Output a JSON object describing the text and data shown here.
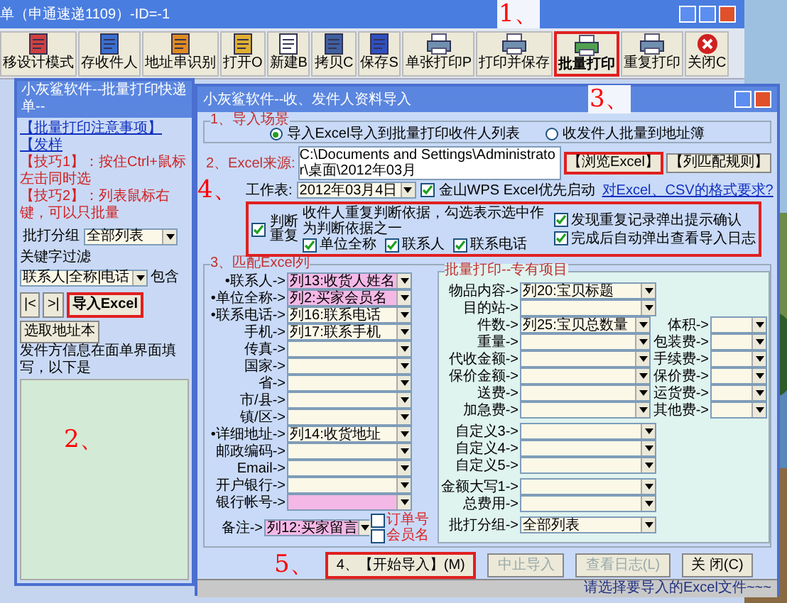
{
  "main_window": {
    "title": "单（申通速递1109）-ID=-1",
    "toolbar": [
      {
        "label": "移设计模式",
        "boxed": false
      },
      {
        "label": "存收件人",
        "boxed": false
      },
      {
        "label": "地址串识别",
        "boxed": false
      },
      {
        "label": "打开O",
        "boxed": false
      },
      {
        "label": "新建B",
        "boxed": false
      },
      {
        "label": "拷贝C",
        "boxed": false
      },
      {
        "label": "保存S",
        "boxed": false
      },
      {
        "label": "单张打印P",
        "boxed": false
      },
      {
        "label": "打印并保存",
        "boxed": false
      },
      {
        "label": "批量打印",
        "boxed": true
      },
      {
        "label": "重复打印",
        "boxed": false
      },
      {
        "label": "关闭C",
        "boxed": false
      }
    ]
  },
  "batch_window": {
    "title": "小灰鲨软件--批量打印快递单--",
    "links": [
      "【批量打印注意事项】",
      "【发样"
    ],
    "tips": [
      "【技巧1】：按住Ctrl+鼠标左击同时选",
      "【技巧2】：列表鼠标右键，可以只批量"
    ],
    "group_label": "批打分组",
    "group_value": "全部列表",
    "filter_label": "关键字过滤",
    "filter_value": "联系人|全称|电话",
    "filter_mode": "包含",
    "nav": [
      {
        "label": "|<",
        "boxed": false
      },
      {
        "label": ">|",
        "boxed": false
      },
      {
        "label": "导入Excel",
        "boxed": true
      },
      {
        "label": "选取地址本",
        "boxed": false
      }
    ],
    "note": "发件方信息在面单界面填写，以下是"
  },
  "import_dialog": {
    "title": "小灰鲨软件--收、发件人资料导入",
    "scene_label": "1、导入场景",
    "scenes": [
      {
        "label": "导入Excel导入到批量打印收件人列表",
        "selected": true
      },
      {
        "label": "收发件人批量到地址簿",
        "selected": false
      }
    ],
    "source_label": "2、Excel来源:",
    "source_value": "C:\\Documents and Settings\\Administrator\\桌面\\2012年03月",
    "browse_button": {
      "label": "【浏览Excel】",
      "boxed": true
    },
    "rules_button": {
      "label": "【列匹配规则】",
      "boxed": false
    },
    "sheet_label": "工作表:",
    "sheet_value": "2012年03月4日",
    "wps": {
      "label": "金山WPS Excel优先启动",
      "checked": true
    },
    "format_link": "对Excel、CSV的格式要求?",
    "dup_check": {
      "label": "判断重复",
      "checked": true
    },
    "dup_hint": "收件人重复判断依据，勾选表示选中作为判断依据之一",
    "dup_fields": [
      {
        "label": "单位全称",
        "checked": true
      },
      {
        "label": "联系人",
        "checked": true
      },
      {
        "label": "联系电话",
        "checked": true
      }
    ],
    "dup_options": [
      {
        "label": "发现重复记录弹出提示确认",
        "checked": true
      },
      {
        "label": "完成后自动弹出查看导入日志",
        "checked": true
      }
    ],
    "match_title": "3、匹配Excel列",
    "fields": [
      {
        "label": "•联系人->",
        "value": "列13:收货人姓名",
        "highlight": true
      },
      {
        "label": "•单位全称->",
        "value": "列2:买家会员名",
        "highlight": true
      },
      {
        "label": "•联系电话->",
        "value": "列16:联系电话",
        "highlight": false
      },
      {
        "label": "手机->",
        "value": "列17:联系手机",
        "highlight": false
      },
      {
        "label": "传真->",
        "highlight": false
      },
      {
        "label": "国家->",
        "highlight": false
      },
      {
        "label": "省->",
        "highlight": false
      },
      {
        "label": "市/县->",
        "highlight": false
      },
      {
        "label": "镇/区->",
        "highlight": false
      },
      {
        "label": "•详细地址->",
        "value": "列14:收货地址",
        "highlight": false
      },
      {
        "label": "邮政编码->",
        "highlight": false
      },
      {
        "label": "Email->",
        "highlight": false
      },
      {
        "label": "开户银行->",
        "highlight": false
      },
      {
        "label": "银行帐号->",
        "highlight": true
      }
    ],
    "remark": {
      "label": "备注->",
      "value": "列12:买家留言",
      "extras": [
        {
          "label": "订单号",
          "checked": false
        },
        {
          "label": "会员名",
          "checked": false
        }
      ]
    },
    "print_group_title": "批量打印--专有项目",
    "print_rows": [
      [
        {
          "label": "物品内容->",
          "value": "列20:宝贝标题"
        }
      ],
      [
        {
          "label": "目的站->"
        }
      ],
      [
        {
          "label": "件数->",
          "value": "列25:宝贝总数量"
        },
        {
          "label": "体积->"
        }
      ],
      [
        {
          "label": "重量->"
        },
        {
          "label": "包装费->"
        }
      ],
      [
        {
          "label": "代收金额->"
        },
        {
          "label": "手续费->"
        }
      ],
      [
        {
          "label": "保价金额->"
        },
        {
          "label": "保价费->"
        }
      ],
      [
        {
          "label": "送费->"
        },
        {
          "label": "运货费->"
        }
      ],
      [
        {
          "label": "加急费->"
        },
        {
          "label": "其他费->"
        }
      ],
      [
        {
          "label": "自定义3->"
        }
      ],
      [
        {
          "label": "自定义4->"
        }
      ],
      [
        {
          "label": "自定义5->"
        }
      ],
      [
        {
          "label": "金额大写1->"
        }
      ],
      [
        {
          "label": "总费用->"
        }
      ],
      [
        {
          "label": "批打分组->",
          "value": "全部列表"
        }
      ]
    ],
    "buttons": [
      {
        "label": "4、【开始导入】(M)",
        "disabled": false,
        "boxed": true
      },
      {
        "label": "中止导入",
        "disabled": true,
        "boxed": false
      },
      {
        "label": "查看日志(L)",
        "disabled": true,
        "boxed": false
      },
      {
        "label": "关 闭(C)",
        "disabled": false,
        "boxed": false
      }
    ],
    "status": "请选择要导入的Excel文件~~~"
  },
  "annotations": [
    "1、",
    "2、",
    "3、",
    "4、",
    "5、"
  ]
}
